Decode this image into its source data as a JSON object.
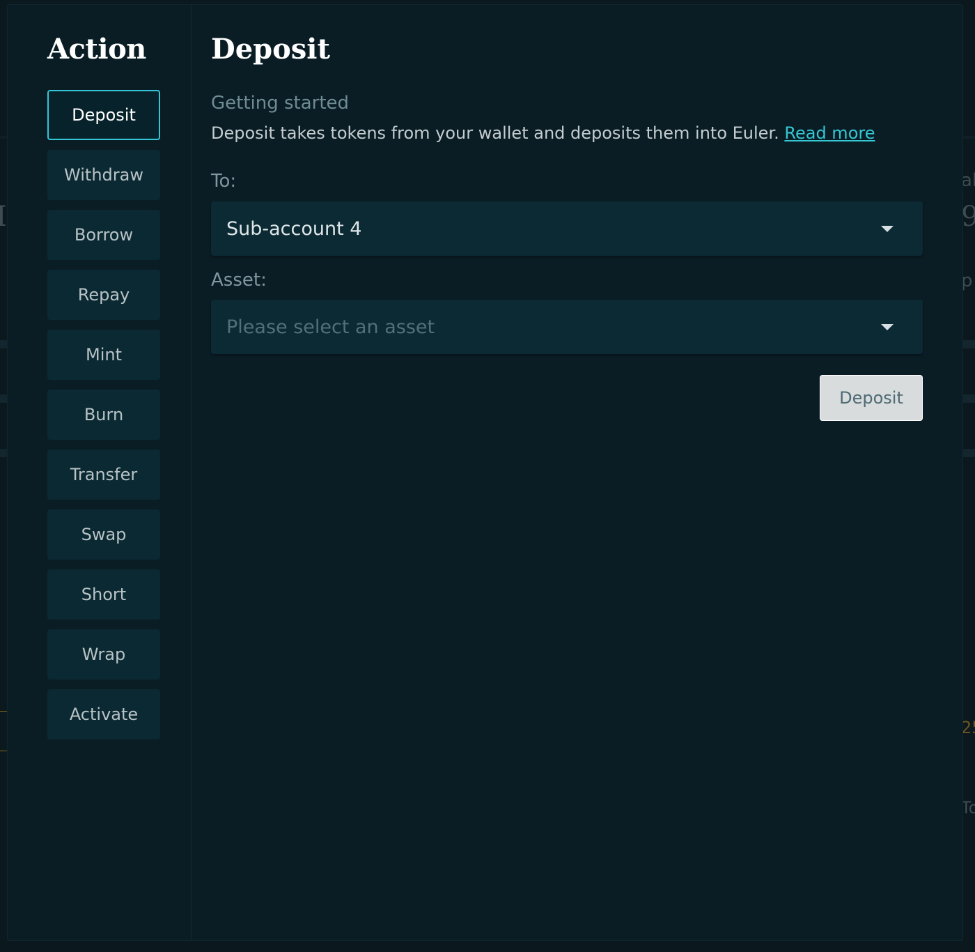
{
  "sidebar": {
    "title": "Action",
    "items": [
      {
        "label": "Deposit",
        "active": true
      },
      {
        "label": "Withdraw"
      },
      {
        "label": "Borrow"
      },
      {
        "label": "Repay"
      },
      {
        "label": "Mint"
      },
      {
        "label": "Burn"
      },
      {
        "label": "Transfer"
      },
      {
        "label": "Swap"
      },
      {
        "label": "Short"
      },
      {
        "label": "Wrap"
      },
      {
        "label": "Activate"
      }
    ]
  },
  "main": {
    "title": "Deposit",
    "getting_started": "Getting started",
    "description": "Deposit takes tokens from your wallet and deposits them into Euler. ",
    "read_more": "Read more",
    "to_label": "To:",
    "to_value": "Sub-account 4",
    "asset_label": "Asset:",
    "asset_placeholder": "Please select an asset",
    "submit_label": "Deposit"
  },
  "colors": {
    "accent": "#33c6d6",
    "modal_bg": "#0a1d24",
    "button_bg": "#0b2932",
    "submit_bg": "#d8dcdd"
  }
}
